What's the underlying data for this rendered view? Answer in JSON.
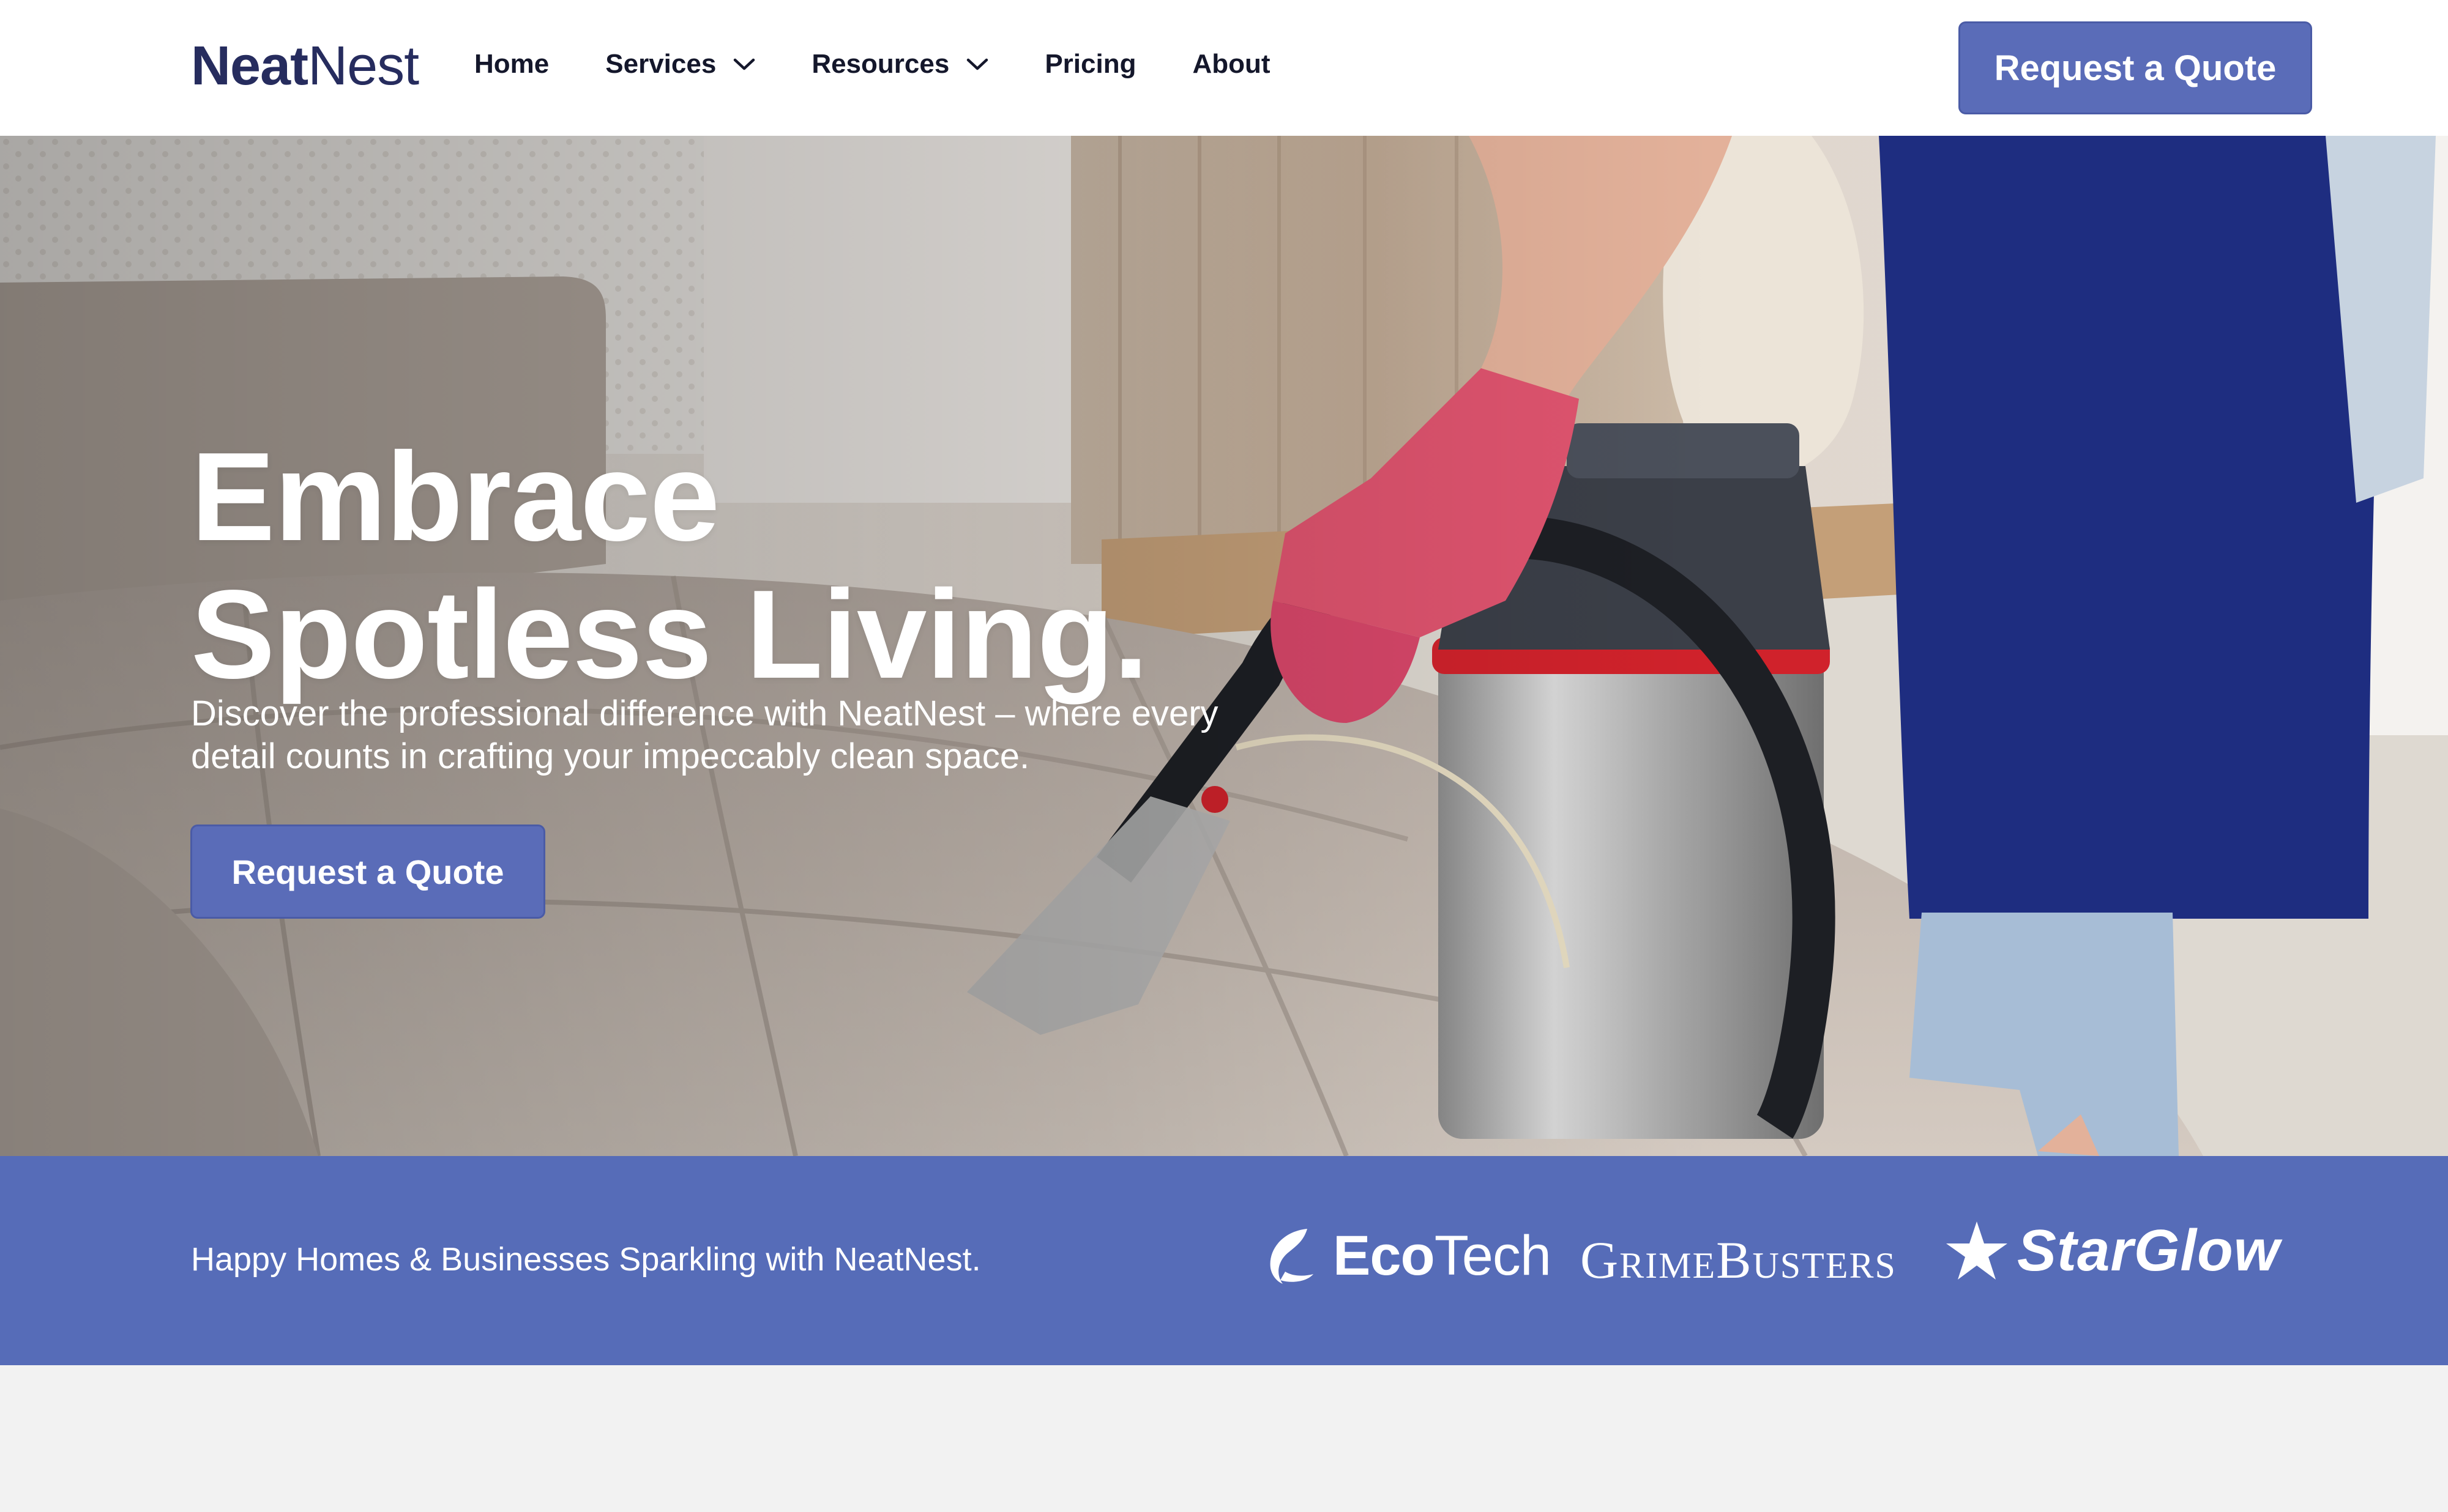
{
  "header": {
    "logo": {
      "bold": "Neat",
      "light": "Nest"
    },
    "nav": [
      {
        "label": "Home"
      },
      {
        "label": "Services"
      },
      {
        "label": "Resources"
      },
      {
        "label": "Pricing"
      },
      {
        "label": "About"
      }
    ],
    "cta_label": "Request a Quote"
  },
  "hero": {
    "title_line1": "Embrace",
    "title_line2": "Spotless Living.",
    "subtitle": "Discover the professional difference with NeatNest – where every detail counts in crafting your impeccably clean space.",
    "cta_label": "Request a Quote",
    "image_semantic": "cleaner-vacuuming-sofa-photo"
  },
  "trust_band": {
    "text": "Happy Homes & Businesses Sparkling with NeatNest.",
    "brands": [
      {
        "bold": "Eco",
        "light": "Tech",
        "icon": "leaf-swoosh-icon"
      },
      {
        "name": "GrimeBusters"
      },
      {
        "name": "StarGlow",
        "icon": "star-icon"
      }
    ]
  },
  "colors": {
    "brand_navy": "#262c5e",
    "accent_blue": "#566cb8",
    "button_blue": "#5a6cb8",
    "glove_pink": "#e0546f",
    "apron_navy": "#1e2d80",
    "page_bg": "#f2f2f2"
  }
}
